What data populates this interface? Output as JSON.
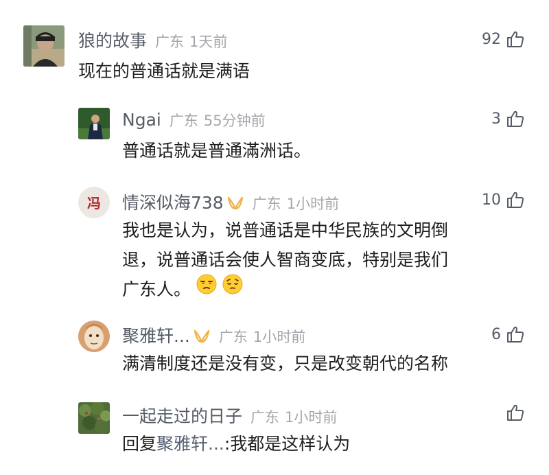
{
  "comments": [
    {
      "name": "狼的故事",
      "location": "广东",
      "time": "1天前",
      "likes": "92",
      "text": "现在的普通话就是满语"
    },
    {
      "name": "Ngai",
      "location": "广东",
      "time": "55分钟前",
      "likes": "3",
      "text": "普通话就是普通滿洲话。"
    },
    {
      "name": "情深似海738",
      "location": "广东",
      "time": "1小时前",
      "likes": "10",
      "text_line1": "我也是认为，说普通话是中华民族的文明倒",
      "text_line2": "退，说普通话会使人智商变底，特别是我们",
      "text_line3": "广东人。",
      "emojis": [
        "unamused-face",
        "pensive-face"
      ]
    },
    {
      "name": "聚雅轩...",
      "location": "广东",
      "time": "1小时前",
      "likes": "6",
      "text": "满清制度还是没有变，只是改变朝代的名称"
    },
    {
      "name": "一起走过的日子",
      "location": "广东",
      "time": "1小时前",
      "likes": "",
      "reply_prefix": "回复",
      "reply_to": "聚雅轩...",
      "reply_text": ":我都是这样认为"
    }
  ],
  "colors": {
    "name": "#555c66",
    "meta": "#a3a6ab",
    "badge": "#f2b24a"
  },
  "icons": [
    "thumbs-up-icon",
    "vip-badge-icon"
  ]
}
